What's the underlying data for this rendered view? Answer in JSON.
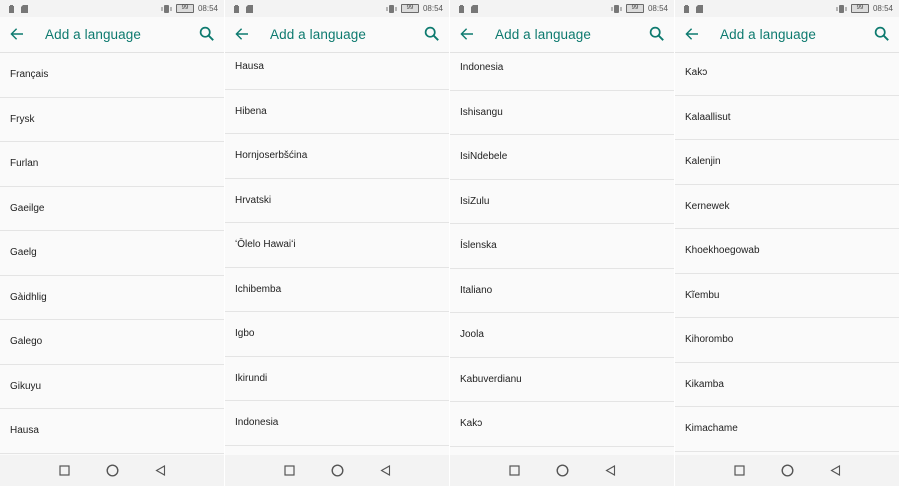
{
  "status": {
    "battery": "99",
    "time": "08:54"
  },
  "app_bar": {
    "title": "Add a language"
  },
  "screens": [
    {
      "items": [
        "Français",
        "Frysk",
        "Furlan",
        "Gaeilge",
        "Gaelg",
        "Gàidhlig",
        "Galego",
        "Gikuyu",
        "Hausa"
      ]
    },
    {
      "items": [
        "Hausa",
        "Hibena",
        "Hornjoserbšćina",
        "Hrvatski",
        "ʻŌlelo Hawaiʻi",
        "Ichibemba",
        "Igbo",
        "Ikirundi",
        "Indonesia"
      ]
    },
    {
      "items": [
        "Indonesia",
        "Ishisangu",
        "IsiNdebele",
        "IsiZulu",
        "Íslenska",
        "Italiano",
        "Joola",
        "Kabuverdianu",
        "Kakɔ"
      ]
    },
    {
      "items": [
        "Kakɔ",
        "Kalaallisut",
        "Kalenjin",
        "Kernewek",
        "Khoekhoegowab",
        "Kĩembu",
        "Kihorombo",
        "Kikamba",
        "Kimachame"
      ]
    }
  ],
  "icons": {
    "back": "arrow-back-icon",
    "search": "search-icon",
    "nav_recents": "square-recents-icon",
    "nav_home": "circle-home-icon",
    "nav_back": "triangle-back-icon"
  },
  "colors": {
    "accent": "#0d7a6f",
    "background": "#fafafa",
    "divider": "#e4e4e4"
  }
}
